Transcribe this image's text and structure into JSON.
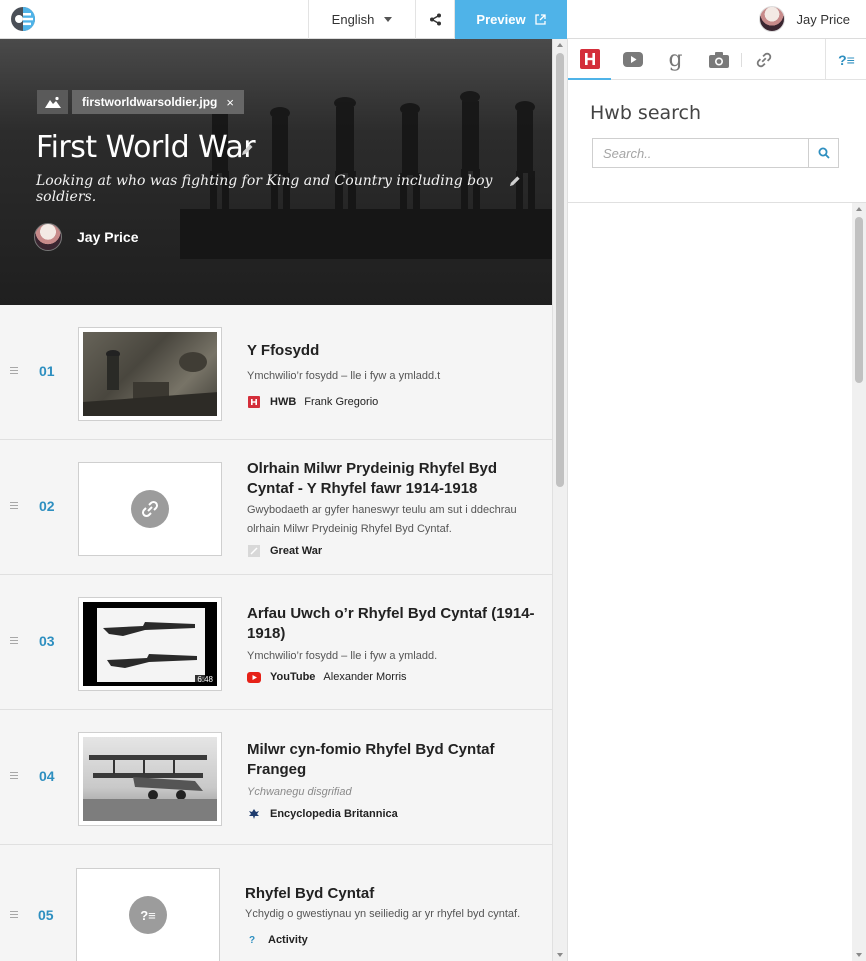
{
  "topbar": {
    "language": "English",
    "preview_label": "Preview",
    "user_name": "Jay Price"
  },
  "hero": {
    "image_name": "firstworldwarsoldier.jpg",
    "remove_symbol": "×",
    "title": "First World War",
    "description": "Looking at who was fighting for King and Country including boy soldiers.",
    "author": "Jay Price"
  },
  "items": [
    {
      "number": "01",
      "title": "Y Ffosydd",
      "subtitle": "Ymchwilio’r fosydd – lle i fyw a ymladd.t",
      "source": "HWB",
      "author": "Frank Gregorio"
    },
    {
      "number": "02",
      "title": "Olrhain Milwr Prydeinig Rhyfel Byd Cyntaf  - Y Rhyfel fawr 1914-1918",
      "subtitle": "Gwybodaeth ar gyfer haneswyr teulu am sut i ddechrau olrhain Milwr Prydeinig Rhyfel Byd Cyntaf.",
      "source": "Great War",
      "author": ""
    },
    {
      "number": "03",
      "title": "Arfau Uwch o’r Rhyfel Byd Cyntaf (1914-1918)",
      "subtitle": "Ymchwilio’r fosydd – lle i fyw a ymladd.",
      "source": "YouTube",
      "author": "Alexander Morris",
      "duration": "6:48"
    },
    {
      "number": "04",
      "title": "Milwr cyn-fomio Rhyfel Byd Cyntaf Frangeg",
      "subtitle": "Ychwanegu disgrifiad",
      "source": "Encyclopedia Britannica",
      "author": ""
    },
    {
      "number": "05",
      "title": "Rhyfel Byd Cyntaf",
      "subtitle": "Ychydig o gwestiynau yn seiliedig ar yr rhyfel byd cyntaf.",
      "source": "Activity",
      "author": ""
    }
  ],
  "right_panel": {
    "title": "Hwb search",
    "search_placeholder": "Search..",
    "hwb_tab_letter": "H",
    "google_tab_letter": "g",
    "help_label": "?≡"
  },
  "colors": {
    "accent": "#4fb3e8",
    "number_blue": "#2e8fc0",
    "hwb_red": "#d42e3a",
    "youtube_red": "#e62117"
  }
}
